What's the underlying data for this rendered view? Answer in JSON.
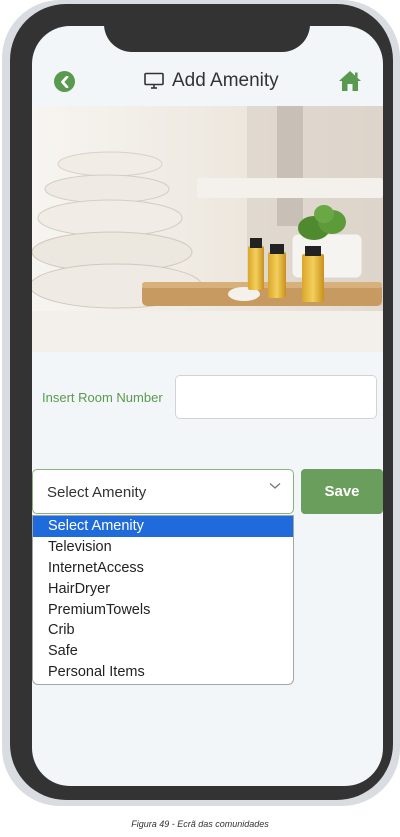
{
  "header": {
    "title": "Add Amenity",
    "back_icon": "chevron-left-circle-icon",
    "title_icon": "monitor-icon",
    "home_icon": "home-icon"
  },
  "form": {
    "room_label": "Insert Room Number",
    "room_value": "",
    "amenity_selected": "Select Amenity",
    "save_label": "Save",
    "options": [
      "Select Amenity",
      "Television",
      "InternetAccess",
      "HairDryer",
      "PremiumTowels",
      "Crib",
      "Safe",
      "Personal Items"
    ]
  },
  "caption": "Figura 49 - Ecrã das comunidades",
  "colors": {
    "accent_green": "#5a9a50",
    "button_green": "#6a9e5c",
    "selection_blue": "#1f6bdc",
    "phone_frame": "#333333"
  }
}
